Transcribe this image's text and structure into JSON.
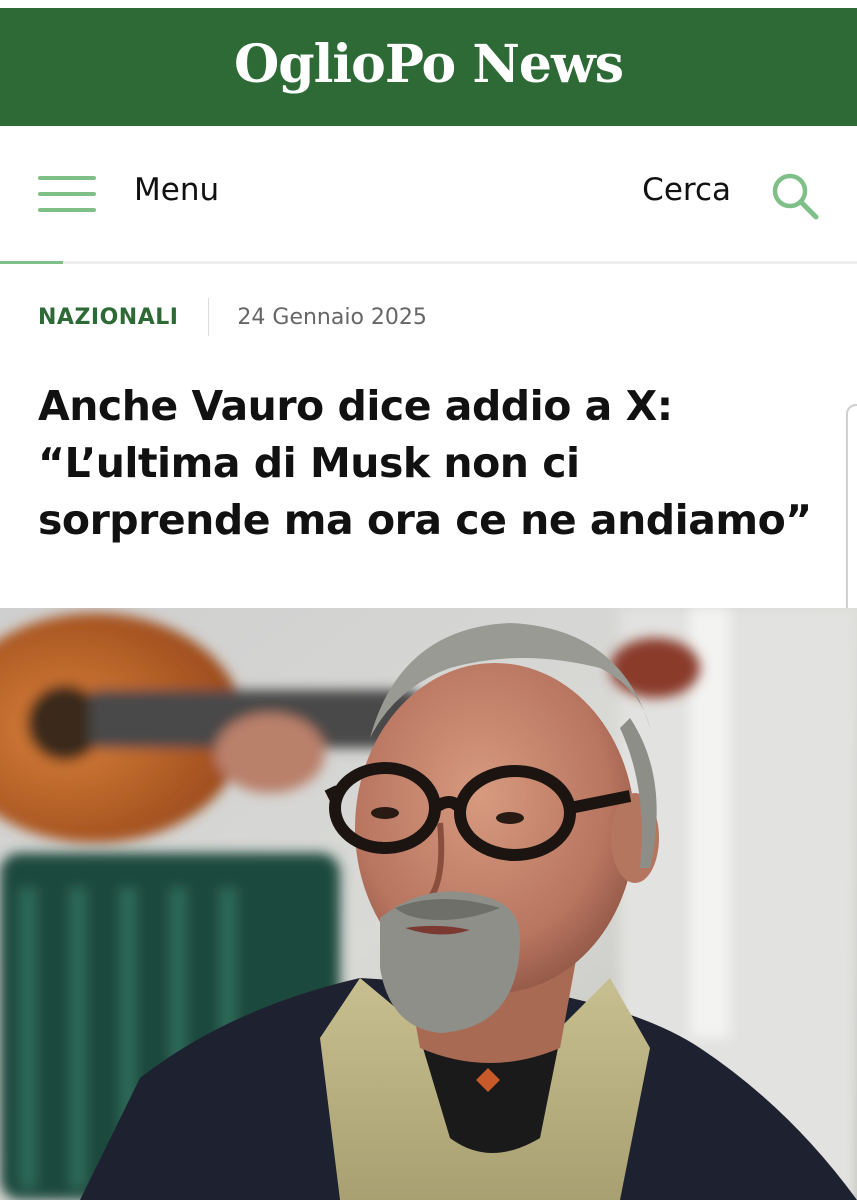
{
  "masthead": {
    "logo_text": "OglioPo News",
    "background_color": "#2d6a35"
  },
  "topbar": {
    "menu_icon": "hamburger-menu-icon",
    "menu_label": "Menu",
    "search_label": "Cerca",
    "search_icon": "search-icon",
    "accent_color": "#7fc089"
  },
  "article": {
    "category": "NAZIONALI",
    "date": "24 Gennaio 2025",
    "headline": "Anche Vauro dice addio a X: “L’ultima di Musk non ci sorprende ma ora ce ne andiamo”"
  }
}
